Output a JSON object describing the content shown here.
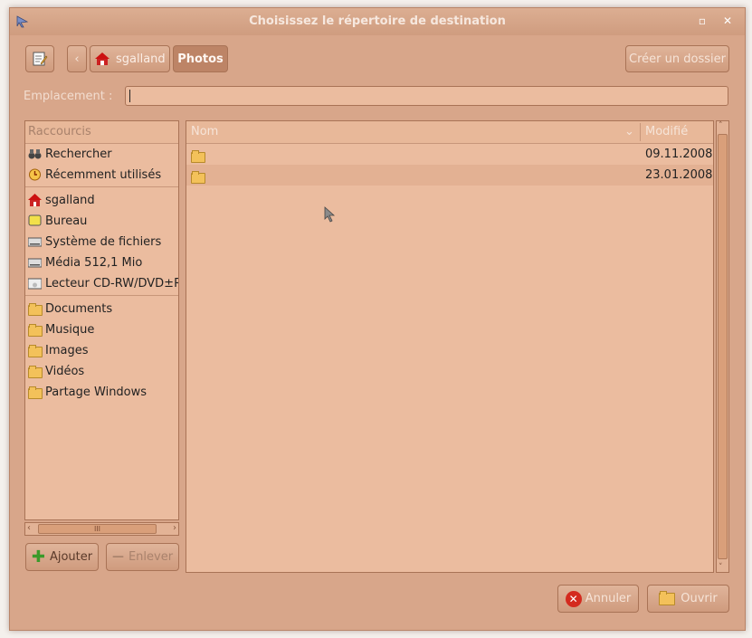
{
  "window": {
    "title": "Choisissez le répertoire de destination"
  },
  "toolbar": {
    "path": [
      "sgalland",
      "Photos"
    ],
    "create_folder_label": "Créer un dossier"
  },
  "location": {
    "label": "Emplacement :",
    "value": ""
  },
  "sidebar": {
    "header": "Raccourcis",
    "groups": [
      [
        {
          "label": "Rechercher",
          "icon": "binoculars-icon"
        },
        {
          "label": "Récemment utilisés",
          "icon": "clock-icon"
        }
      ],
      [
        {
          "label": "sgalland",
          "icon": "home-icon"
        },
        {
          "label": "Bureau",
          "icon": "desktop-icon"
        },
        {
          "label": "Système de fichiers",
          "icon": "drive-icon"
        },
        {
          "label": "Média 512,1 Mio",
          "icon": "drive-icon"
        },
        {
          "label": "Lecteur CD-RW/DVD±RW",
          "icon": "cdrom-icon"
        }
      ],
      [
        {
          "label": "Documents",
          "icon": "folder-icon"
        },
        {
          "label": "Musique",
          "icon": "folder-icon"
        },
        {
          "label": "Images",
          "icon": "folder-icon"
        },
        {
          "label": "Vidéos",
          "icon": "folder-icon"
        },
        {
          "label": "Partage Windows",
          "icon": "folder-icon"
        }
      ]
    ],
    "add_label": "Ajouter",
    "remove_label": "Enlever"
  },
  "filelist": {
    "columns": {
      "name": "Nom",
      "modified": "Modifié"
    },
    "rows": [
      {
        "name": "",
        "modified": "09.11.2008"
      },
      {
        "name": "",
        "modified": "23.01.2008"
      }
    ]
  },
  "buttons": {
    "cancel": "Annuler",
    "open": "Ouvrir"
  },
  "colors": {
    "accent": "#d8a68a",
    "cancel_icon": "#d42a1e"
  }
}
